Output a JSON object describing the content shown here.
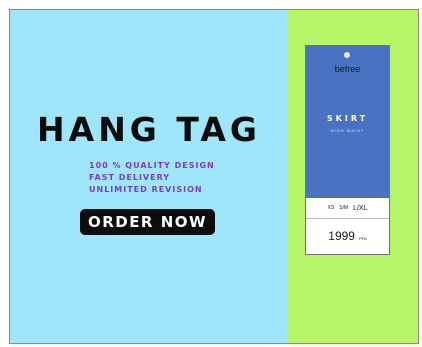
{
  "headline": "HANG TAG",
  "features": [
    "100 % QUALITY DESIGN",
    "FAST DELIVERY",
    "UNLIMITED REVISION"
  ],
  "cta_label": "ORDER NOW",
  "tag": {
    "brand": "befree",
    "product": "SKIRT",
    "product_sub": "HIGH WAIST",
    "sizes": [
      "XS",
      "S/M",
      "L/XL"
    ],
    "price": "1999",
    "currency": "РУБ"
  },
  "colors": {
    "left_bg": "#9fe6fb",
    "right_bg": "#b6f567",
    "feature_text": "#7a3dbf",
    "tag_blue": "#4a72c2",
    "button_bg": "#0d0d0d"
  }
}
